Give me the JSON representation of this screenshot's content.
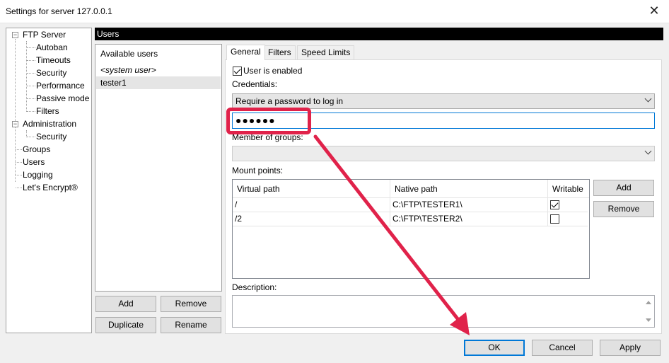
{
  "window": {
    "title": "Settings for server 127.0.0.1",
    "close_glyph": "✕"
  },
  "tree": {
    "items": [
      {
        "label": "FTP Server",
        "toggle": "−"
      },
      {
        "label": "Autoban"
      },
      {
        "label": "Timeouts"
      },
      {
        "label": "Security"
      },
      {
        "label": "Performance"
      },
      {
        "label": "Passive mode"
      },
      {
        "label": "Filters"
      },
      {
        "label": "Administration",
        "toggle": "−"
      },
      {
        "label": "Security"
      },
      {
        "label": "Groups"
      },
      {
        "label": "Users"
      },
      {
        "label": "Logging"
      },
      {
        "label": "Let's Encrypt®"
      }
    ]
  },
  "section": {
    "title": "Users"
  },
  "users": {
    "header": "Available users",
    "rows": [
      "<system user>",
      "tester1"
    ],
    "add_label": "Add",
    "remove_label": "Remove",
    "duplicate_label": "Duplicate",
    "rename_label": "Rename"
  },
  "tabs": [
    "General",
    "Filters",
    "Speed Limits"
  ],
  "general": {
    "user_enabled_label": "User is enabled",
    "credentials_label": "Credentials:",
    "credentials_value": "Require a password to log in",
    "password_value": "●●●●●●",
    "groups_label": "Member of groups:",
    "groups_value": "",
    "mounts_label": "Mount points:",
    "mounts_columns": [
      "Virtual path",
      "Native path",
      "Writable"
    ],
    "mounts_rows": [
      {
        "virtual": "/",
        "native": "C:\\FTP\\TESTER1\\",
        "writable": true
      },
      {
        "virtual": "/2",
        "native": "C:\\FTP\\TESTER2\\",
        "writable": false
      }
    ],
    "mounts_add_label": "Add",
    "mounts_remove_label": "Remove",
    "description_label": "Description:",
    "description_value": ""
  },
  "footer": {
    "ok_label": "OK",
    "cancel_label": "Cancel",
    "apply_label": "Apply"
  },
  "colors": {
    "annotation": "#e0224a",
    "focus": "#0078d7",
    "header_bg": "#000000"
  }
}
